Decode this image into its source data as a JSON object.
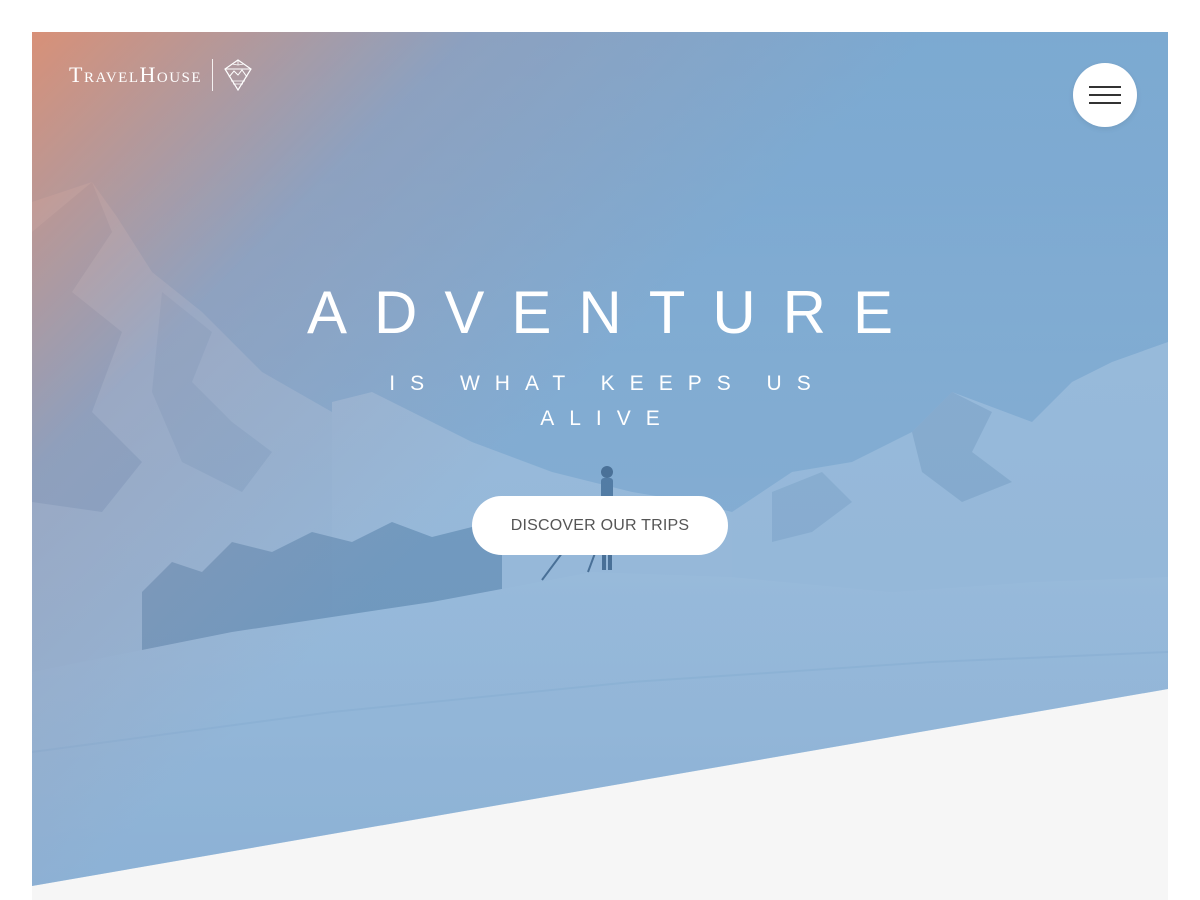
{
  "brand": {
    "name": "TravelHouse",
    "icon": "mountain-diamond-icon"
  },
  "header": {
    "menu_icon": "hamburger-menu-icon"
  },
  "hero": {
    "title": "ADVENTURE",
    "subtitle": "IS WHAT KEEPS US ALIVE",
    "cta_label": "DISCOVER OUR TRIPS"
  },
  "colors": {
    "overlay_blue": "#5f96c8",
    "overlay_peach": "#e88c68",
    "cta_text": "#555555",
    "section_background": "#f6f6f6"
  }
}
